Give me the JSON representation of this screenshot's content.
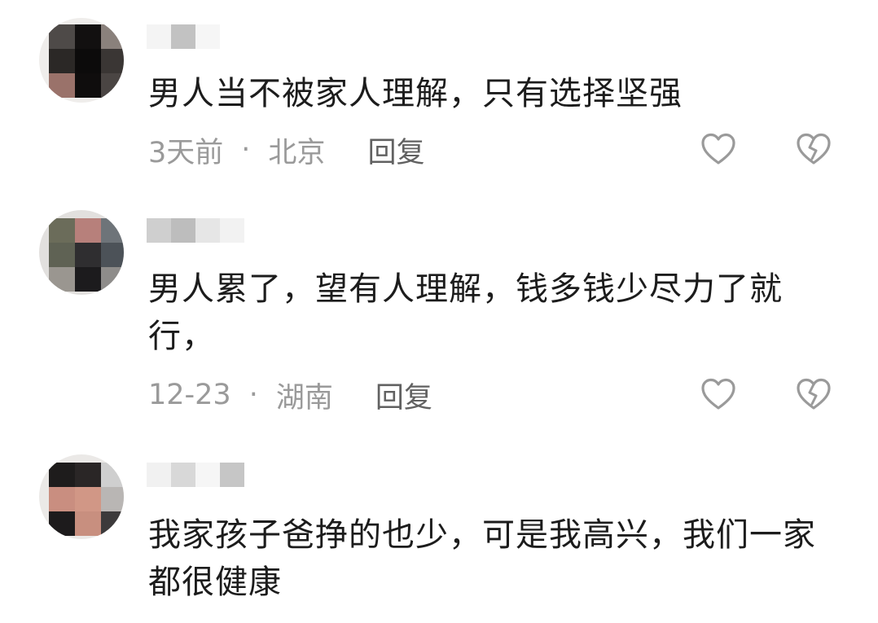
{
  "comments": [
    {
      "text": "男人当不被家人理解，只有选择坚强",
      "time": "3天前",
      "separator": "·",
      "location": "北京",
      "reply_label": "回复",
      "like_icon": "heart-outline-icon",
      "dislike_icon": "broken-heart-icon"
    },
    {
      "text": "男人累了，望有人理解，钱多钱少尽力了就行，",
      "time": "12-23",
      "separator": "·",
      "location": "湖南",
      "reply_label": "回复",
      "like_icon": "heart-outline-icon",
      "dislike_icon": "broken-heart-icon"
    },
    {
      "text": "我家孩子爸挣的也少，可是我高兴，我们一家都很健康"
    }
  ],
  "colors": {
    "text": "#1c1c1c",
    "meta": "#9a9a9a",
    "reply": "#616161",
    "icon": "#9a9a9a"
  }
}
